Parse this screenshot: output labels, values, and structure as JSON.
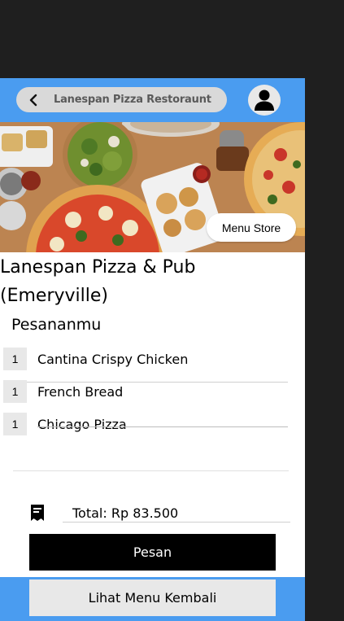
{
  "header": {
    "title": "Lanespan Pizza Restoraunt",
    "back_icon": "chevron-left-icon",
    "avatar_icon": "user-icon"
  },
  "hero": {
    "image": "pizza-table-photo",
    "menu_store_label": "Menu Store"
  },
  "store": {
    "name": "Lanespan Pizza & Pub (Emeryville)"
  },
  "orders": {
    "section_title": "Pesananmu",
    "items": [
      {
        "qty": "1",
        "name": "Cantina Crispy Chicken"
      },
      {
        "qty": "1",
        "name": "French Bread"
      },
      {
        "qty": "1",
        "name": "Chicago Pizza"
      }
    ]
  },
  "summary": {
    "receipt_icon": "receipt-icon",
    "total_text": "Total:  Rp 83.500"
  },
  "actions": {
    "pesan_label": "Pesan",
    "lihat_menu_label": "Lihat Menu Kembali"
  },
  "colors": {
    "bar_blue": "#4a9cf0",
    "page_bg": "#1f1f1f",
    "primary_button": "#000000",
    "secondary_button": "#e8e8e8"
  }
}
